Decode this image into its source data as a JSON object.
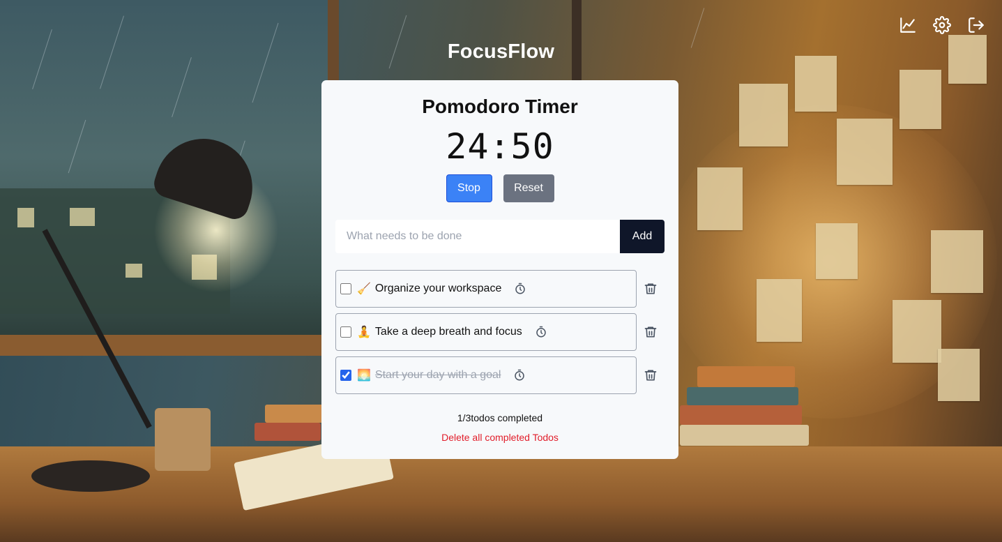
{
  "app": {
    "title": "FocusFlow"
  },
  "header_icons": [
    {
      "name": "chart-icon"
    },
    {
      "name": "gear-icon"
    },
    {
      "name": "logout-icon"
    }
  ],
  "timer": {
    "title": "Pomodoro Timer",
    "display": "24:50",
    "stop_label": "Stop",
    "reset_label": "Reset"
  },
  "todo_form": {
    "placeholder": "What needs to be done",
    "value": "",
    "add_label": "Add"
  },
  "todos": [
    {
      "emoji": "🧹",
      "text": "Organize your workspace",
      "completed": false
    },
    {
      "emoji": "🧘",
      "text": "Take a deep breath and focus",
      "completed": false
    },
    {
      "emoji": "🌅",
      "text": "Start your day with a goal",
      "completed": true
    }
  ],
  "summary": {
    "completed_text": "1/3todos completed",
    "delete_completed_label": "Delete all completed Todos"
  },
  "colors": {
    "primary_button": "#3b82f6",
    "secondary_button": "#6b7280",
    "add_button": "#0f1629",
    "danger_text": "#e11d2a",
    "card_background": "#f7f9fb"
  }
}
